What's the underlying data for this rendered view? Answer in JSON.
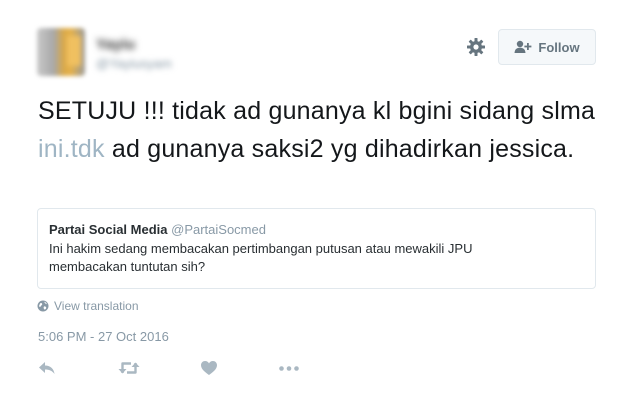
{
  "author": {
    "name": "Yayiu",
    "handle": "@Yayiusyam"
  },
  "follow": {
    "label": "Follow"
  },
  "tweet": {
    "text_before": "SETUJU !!! tidak ad gunanya kl bgini sidang slma ",
    "link": "ini.tdk",
    "text_after": " ad gunanya saksi2 yg dihadirkan jessica."
  },
  "quote": {
    "name": "Partai Social Media",
    "handle": "@PartaiSocmed",
    "body": "Ini hakim sedang membacakan pertimbangan putusan atau mewakili JPU membacakan tuntutan sih?"
  },
  "translation": {
    "label": "View translation"
  },
  "timestamp": "5:06 PM - 27 Oct 2016",
  "icons": {
    "settings": "gear-icon",
    "follow": "add-user-icon",
    "translate": "globe-icon",
    "reply": "reply-icon",
    "retweet": "retweet-icon",
    "like": "heart-icon",
    "more": "more-icon"
  },
  "colors": {
    "text": "#14171a",
    "secondary": "#8899a6",
    "link": "#9fb5c4",
    "border": "#e1e8ed",
    "button_bg": "#f5f8fa",
    "icon": "#aab8c2"
  }
}
